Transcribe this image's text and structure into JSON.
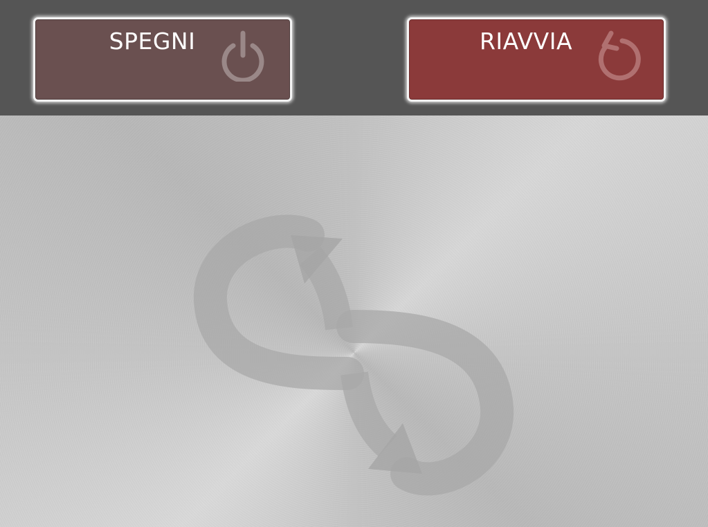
{
  "top_bar": {
    "shutdown_button": {
      "label": "SPEGNI",
      "icon": "power-icon",
      "background": "#6a5050"
    },
    "restart_button": {
      "label": "RIAVVIA",
      "icon": "restart-icon",
      "background": "#8b3a3a"
    },
    "bar_color": "#555555"
  },
  "background": {
    "style": "brushed-metal",
    "logo_icon": "infinity-arrows-icon"
  }
}
